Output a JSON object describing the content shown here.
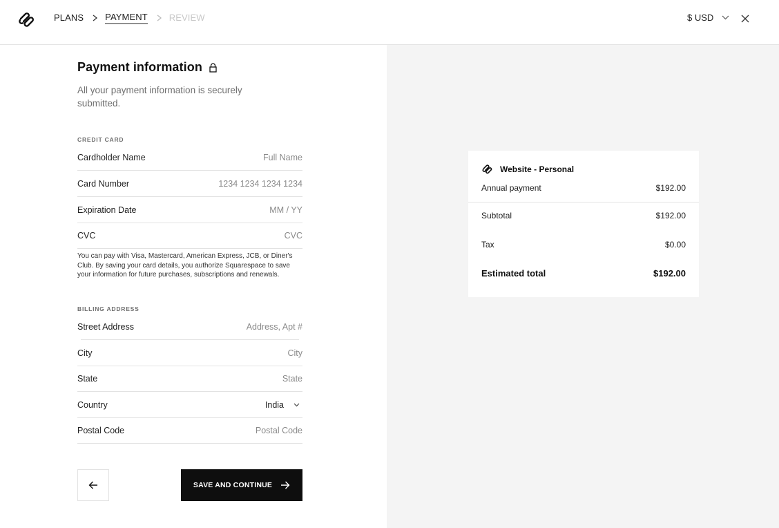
{
  "header": {
    "breadcrumbs": [
      {
        "label": "PLANS",
        "state": "done"
      },
      {
        "label": "PAYMENT",
        "state": "active"
      },
      {
        "label": "REVIEW",
        "state": "disabled"
      }
    ],
    "currency": "$ USD",
    "icons": {
      "logo": "squarespace-logo-icon",
      "separator": "chevron-right-icon",
      "currency_dropdown": "chevron-down-icon",
      "close": "close-icon"
    }
  },
  "form": {
    "title": "Payment information",
    "title_icon": "lock-icon",
    "subtitle": "All your payment information is securely submitted.",
    "credit_card": {
      "section_label": "CREDIT CARD",
      "fields": [
        {
          "label": "Cardholder Name",
          "placeholder": "Full Name"
        },
        {
          "label": "Card Number",
          "placeholder": "1234 1234 1234 1234"
        },
        {
          "label": "Expiration Date",
          "placeholder": "MM / YY"
        },
        {
          "label": "CVC",
          "placeholder": "CVC"
        }
      ],
      "disclaimer": "You can pay with Visa, Mastercard, American Express, JCB, or Diner's Club. By saving your card details, you authorize Squarespace to save your information for future purchases, subscriptions and renewals."
    },
    "billing_address": {
      "section_label": "BILLING ADDRESS",
      "fields": [
        {
          "label": "Street Address",
          "placeholder": "Address, Apt #"
        },
        {
          "label": "City",
          "placeholder": "City"
        },
        {
          "label": "State",
          "placeholder": "State"
        },
        {
          "label": "Country",
          "value": "India"
        },
        {
          "label": "Postal Code",
          "placeholder": "Postal Code"
        }
      ]
    },
    "back_button_icon": "arrow-left-icon",
    "save_button_label": "SAVE AND CONTINUE",
    "save_button_icon": "arrow-right-icon"
  },
  "summary": {
    "plan_name": "Website - Personal",
    "rows": [
      {
        "label": "Annual payment",
        "value": "$192.00"
      },
      {
        "label": "Subtotal",
        "value": "$192.00"
      },
      {
        "label": "Tax",
        "value": "$0.00"
      }
    ],
    "total": {
      "label": "Estimated total",
      "value": "$192.00"
    }
  },
  "colors": {
    "primary_button": "#0e0e0e",
    "panel_background": "#f4f4f4",
    "disabled_text": "#c8c8c8",
    "placeholder_text": "#8a8a8a"
  }
}
